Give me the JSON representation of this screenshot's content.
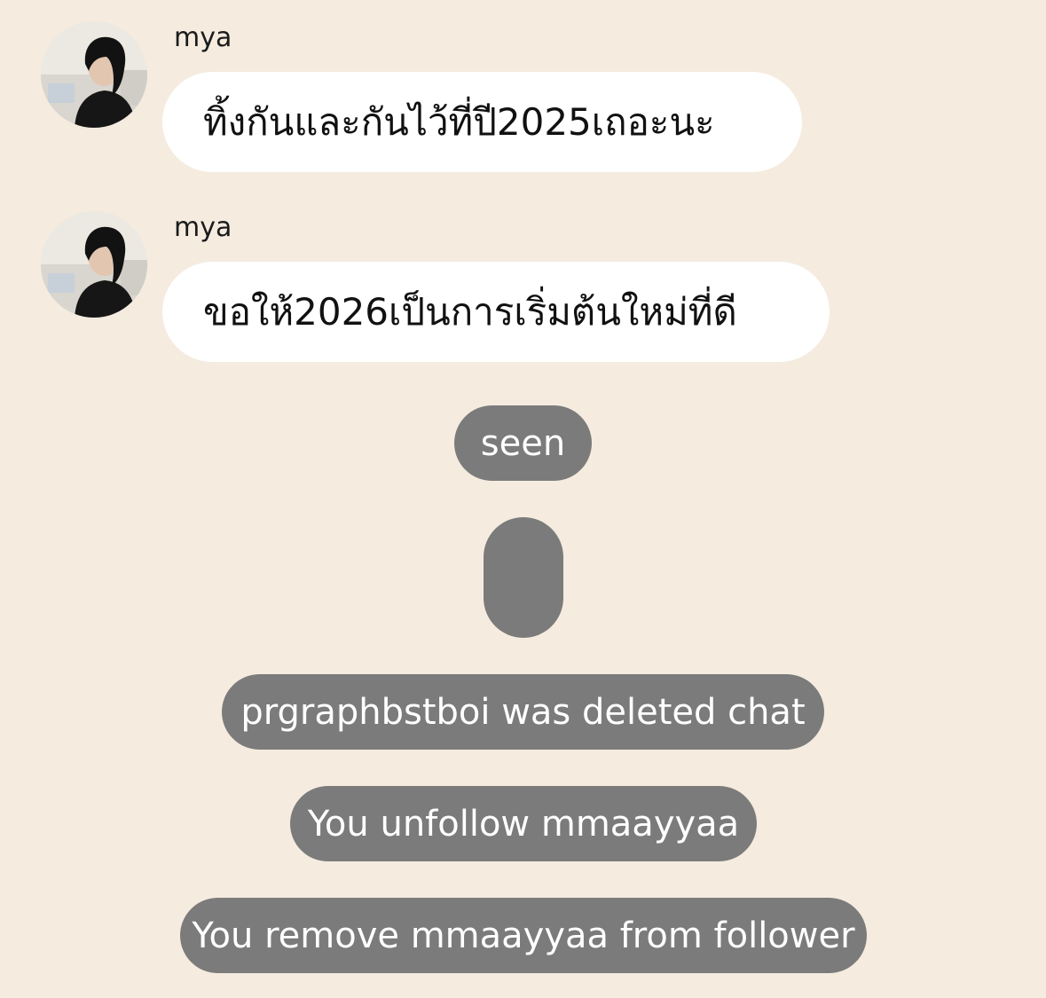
{
  "messages": [
    {
      "sender": "mya",
      "text": "ทิ้งกันและกันไว้ที่ปี2025เถอะนะ"
    },
    {
      "sender": "mya",
      "text": "ขอให้2026เป็นการเริ่มต้นใหม่ที่ดี"
    }
  ],
  "status": {
    "seen": "seen"
  },
  "system_messages": [
    "prgraphbstboi was deleted chat",
    "You unfollow mmaayyaa",
    "You remove mmaayyaa from follower"
  ],
  "colors": {
    "background": "#f5ebdf",
    "bubble": "#ffffff",
    "system_pill": "#7b7b7b"
  }
}
